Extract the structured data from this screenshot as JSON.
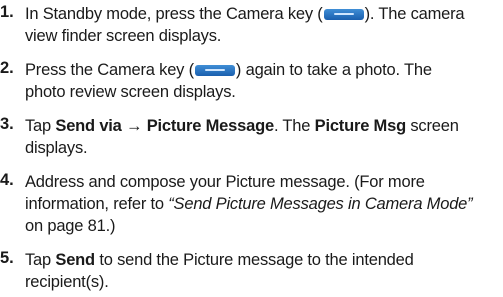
{
  "steps": [
    {
      "number": "1.",
      "line1_a": "In Standby mode, press the Camera key (",
      "line1_b": "). The camera",
      "line2": "view finder screen displays."
    },
    {
      "number": "2.",
      "line1_a": "Press the Camera key (",
      "line1_b": ") again to take a photo. The",
      "line2": "photo review screen displays."
    },
    {
      "number": "3.",
      "line1_a": "Tap ",
      "line1_bold1": "Send via → Picture Message",
      "line1_b": ". The ",
      "line1_bold2": "Picture Msg",
      "line1_c": " screen",
      "line2": "displays."
    },
    {
      "number": "4.",
      "line1": "Address and compose your Picture message. (For more",
      "line2_a": "information, refer to ",
      "line2_italic": "“Send Picture Messages in Camera Mode”",
      "line3": "on page 81.)"
    },
    {
      "number": "5.",
      "line1_a": "Tap ",
      "line1_bold": "Send",
      "line1_b": " to send the Picture message to the intended",
      "line2": "recipient(s)."
    }
  ],
  "icons": {
    "camera_key": "camera-key-icon"
  },
  "colors": {
    "camera_key": "#2a74c4",
    "text": "#1a1a1a"
  }
}
